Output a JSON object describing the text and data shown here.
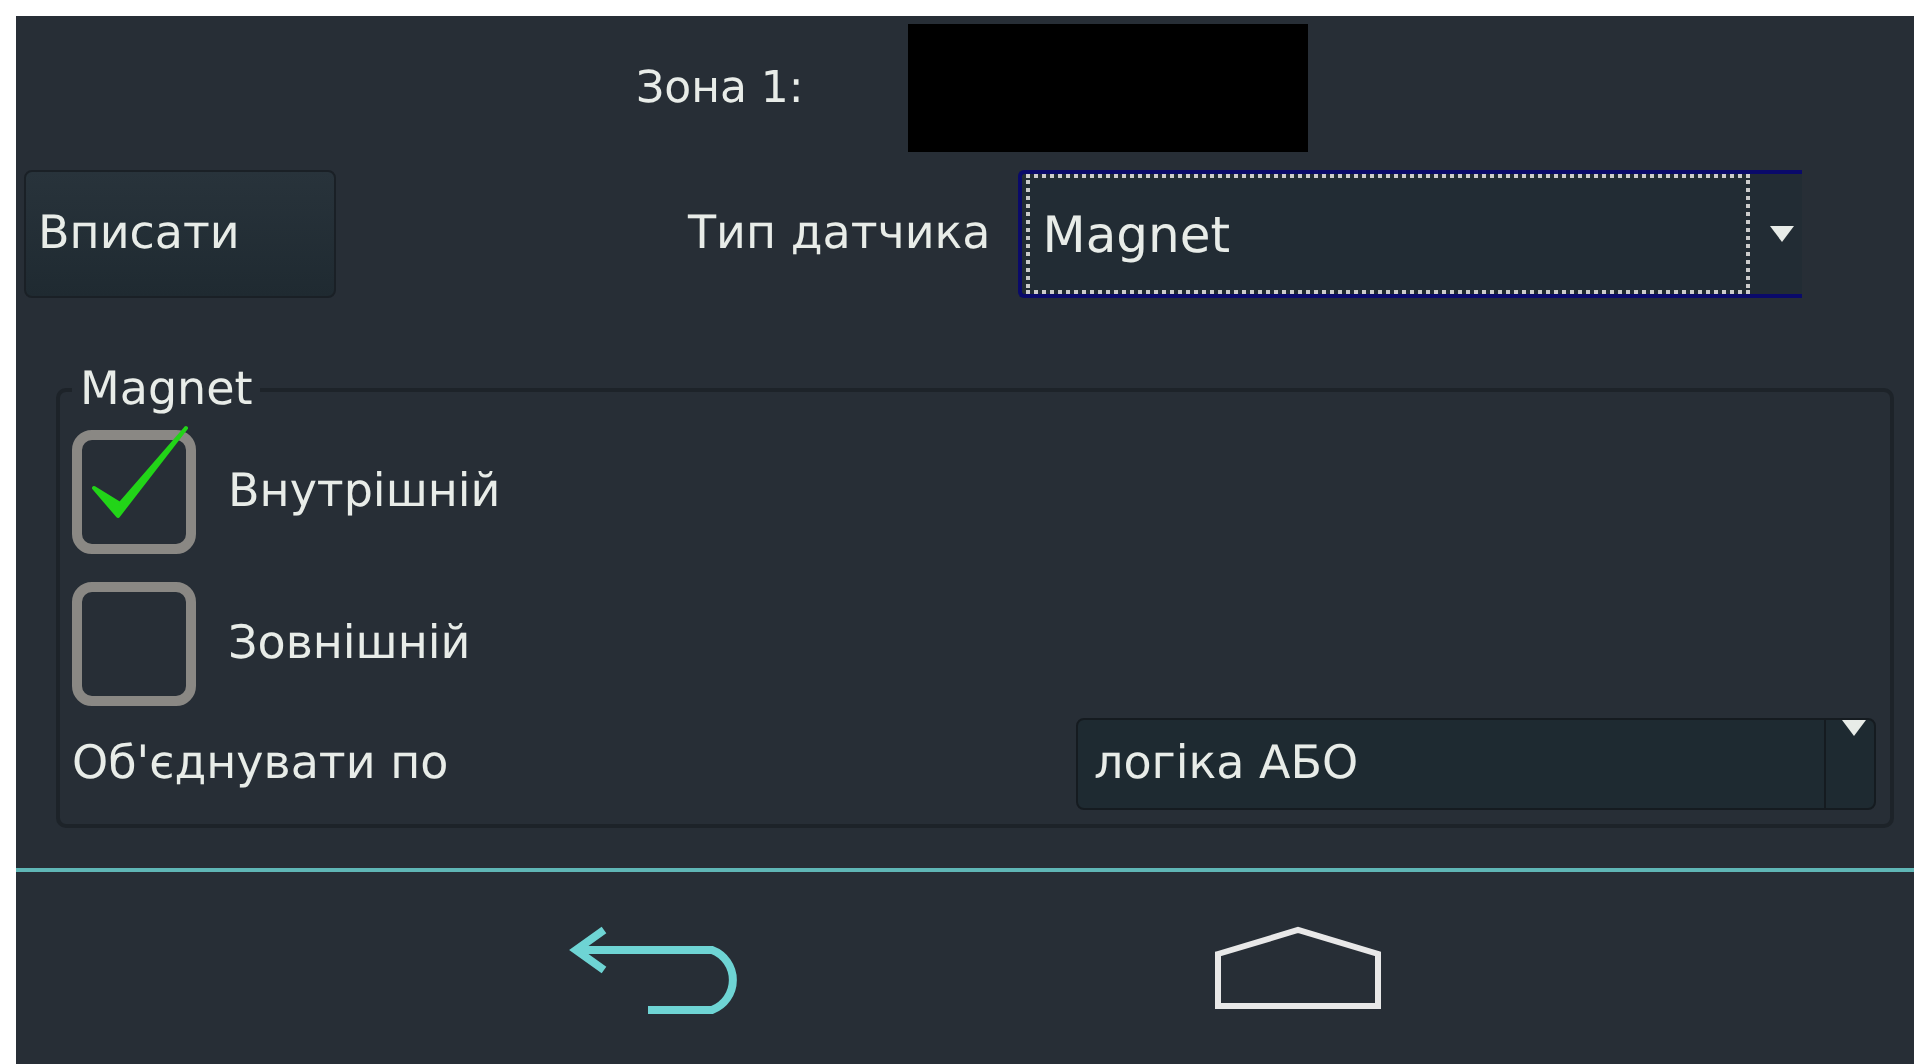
{
  "zone": {
    "label": "Зона 1:"
  },
  "write_button": {
    "label": "Вписати"
  },
  "sensor_type": {
    "label": "Тип датчика",
    "value": "Magnet",
    "focused": true
  },
  "group": {
    "title": "Magnet",
    "options": [
      {
        "label": "Внутрішній",
        "checked": true
      },
      {
        "label": "Зовнішній",
        "checked": false
      }
    ],
    "combine": {
      "label": "Об'єднувати по",
      "value": "логіка АБО"
    }
  }
}
